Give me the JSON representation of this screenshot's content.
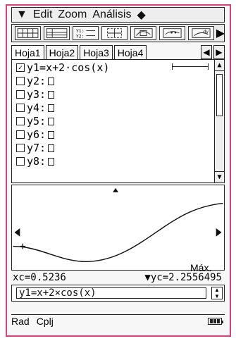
{
  "menu": {
    "main_icon": "chevron-down-icon",
    "items": [
      "Edit",
      "Zoom",
      "Análisis",
      "◆"
    ]
  },
  "tabs": {
    "items": [
      "Hoja1",
      "Hoja2",
      "Hoja3",
      "Hoja4"
    ],
    "active": "Hoja1"
  },
  "function_list": {
    "rows": [
      {
        "label": "y1=x+2·cos(x)",
        "checked": true
      },
      {
        "label": "y2:",
        "checked": false
      },
      {
        "label": "y3:",
        "checked": false
      },
      {
        "label": "y4:",
        "checked": false
      },
      {
        "label": "y5:",
        "checked": false
      },
      {
        "label": "y6:",
        "checked": false
      },
      {
        "label": "y7:",
        "checked": false
      },
      {
        "label": "y8:",
        "checked": false
      }
    ]
  },
  "graph": {
    "max_label": "Máx."
  },
  "coords": {
    "xc": "xc=0.5236",
    "yc": "yc=2.2556495"
  },
  "entry": {
    "value": "y1=x+2×cos(x)"
  },
  "status": {
    "mode": "Rad",
    "format": "Cplj"
  }
}
